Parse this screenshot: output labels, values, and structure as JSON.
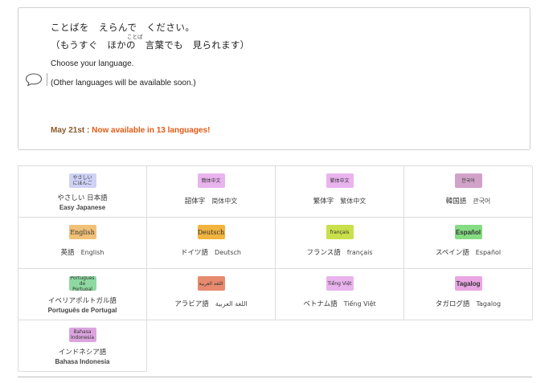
{
  "notice": {
    "jp_line1": "ことばを　えらんで　ください。",
    "jp_line2_a": "（もうすぐ　ほかの　",
    "jp_line2_b": "言葉",
    "jp_line2_c": "でも　見られます）",
    "ruby": "ことば",
    "en_line1": "Choose your language.",
    "en_line2": "(Other languages will be available soon.)",
    "news_date": "May 21st : ",
    "news_text": "Now available in 13 languages!",
    "colors": {
      "date": "#8a5a28",
      "highlight": "#e25a13"
    }
  },
  "languages": [
    {
      "badge": "やさしい\nにほんご",
      "badge_color": "#cfd2f5",
      "badge_style": "small",
      "name": "やさしい 日本語",
      "sub": "Easy Japanese",
      "layout": "two"
    },
    {
      "badge": "簡体中文",
      "badge_color": "#e9b3ee",
      "badge_style": "small",
      "name": "韶体字",
      "sub": "简体中文",
      "layout": "one"
    },
    {
      "badge": "繁体中文",
      "badge_color": "#e9b3ee",
      "badge_style": "small",
      "name": "繁体字",
      "sub": "繁体中文",
      "layout": "one"
    },
    {
      "badge": "한국어",
      "badge_color": "#d1a2c8",
      "badge_style": "small",
      "name": "韓国語",
      "sub": "관국어",
      "layout": "one"
    },
    {
      "badge": "English",
      "badge_color": "#f2c178",
      "badge_style": "serif",
      "name": "英語",
      "sub": "English",
      "layout": "one"
    },
    {
      "badge": "Deutsch",
      "badge_color": "#f2b43f",
      "badge_style": "serif",
      "name": "ドイツ語",
      "sub": "Deutsch",
      "layout": "one"
    },
    {
      "badge": "français",
      "badge_color": "#c9e04a",
      "badge_style": "small",
      "name": "フランス語",
      "sub": "français",
      "layout": "one"
    },
    {
      "badge": "Español",
      "badge_color": "#86dc83",
      "badge_style": "bold",
      "name": "スペイン語",
      "sub": "Español",
      "layout": "one"
    },
    {
      "badge": "Português\nde Portugal",
      "badge_color": "#8ed9a1",
      "badge_style": "small",
      "name": "イベリアポルトガル語",
      "sub": "Português de Portugal",
      "layout": "two"
    },
    {
      "badge": "اللغة العربية",
      "badge_color": "#e88a6e",
      "badge_style": "small",
      "name": "アラビア語",
      "sub": "اللغة العربية",
      "layout": "one"
    },
    {
      "badge": "Tiếng Việt",
      "badge_color": "#e9b3ee",
      "badge_style": "small",
      "name": "ベトナム語",
      "sub": "Tiếng Việt",
      "layout": "one"
    },
    {
      "badge": "Tagalog",
      "badge_color": "#e9a6e3",
      "badge_style": "bold",
      "name": "タガログ語",
      "sub": "Tagalog",
      "layout": "one"
    },
    {
      "badge": "Bahasa\nIndonesia",
      "badge_color": "#dba4df",
      "badge_style": "small",
      "name": "インドネシア語",
      "sub": "Bahasa Indonesia",
      "layout": "two"
    }
  ]
}
